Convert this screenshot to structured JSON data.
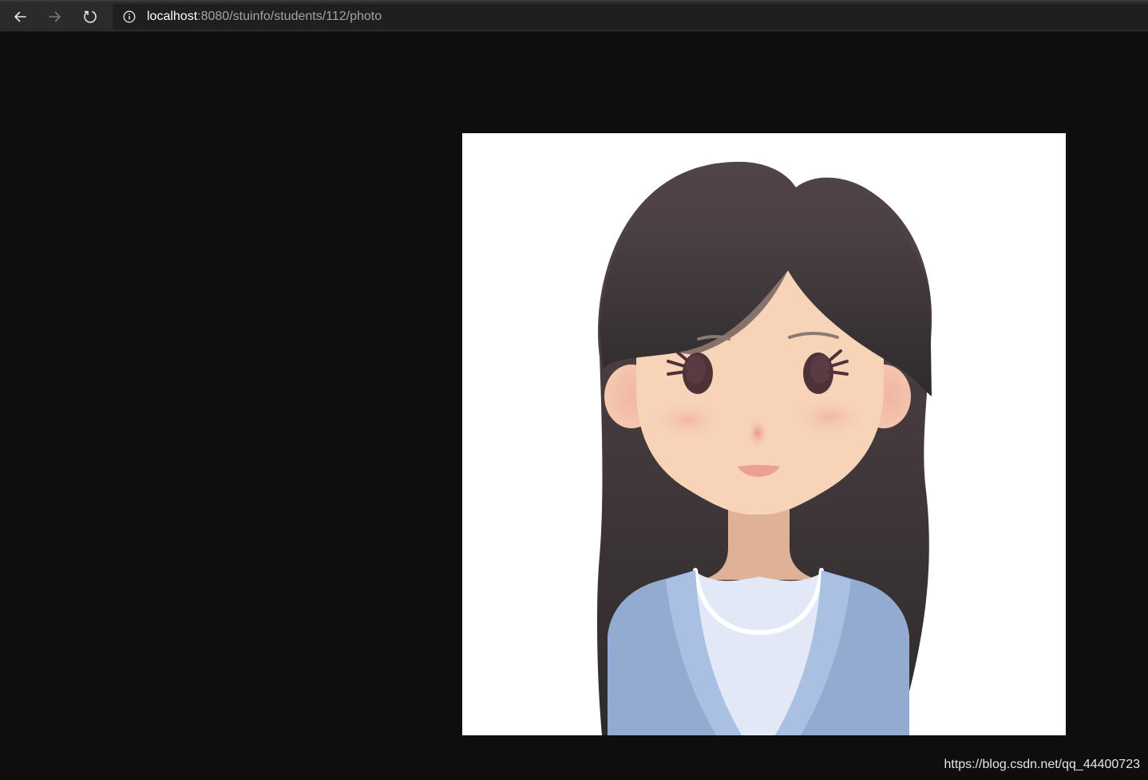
{
  "browser": {
    "url_host": "localhost",
    "url_path": ":8080/stuinfo/students/112/photo",
    "icons": {
      "back": "back-arrow-icon",
      "forward": "forward-arrow-icon",
      "reload": "reload-icon",
      "site_info": "info-icon"
    }
  },
  "page": {
    "background": "#0e0e0e",
    "image_subject": "cartoon-girl-avatar"
  },
  "watermark": "https://blog.csdn.net/qq_44400723"
}
